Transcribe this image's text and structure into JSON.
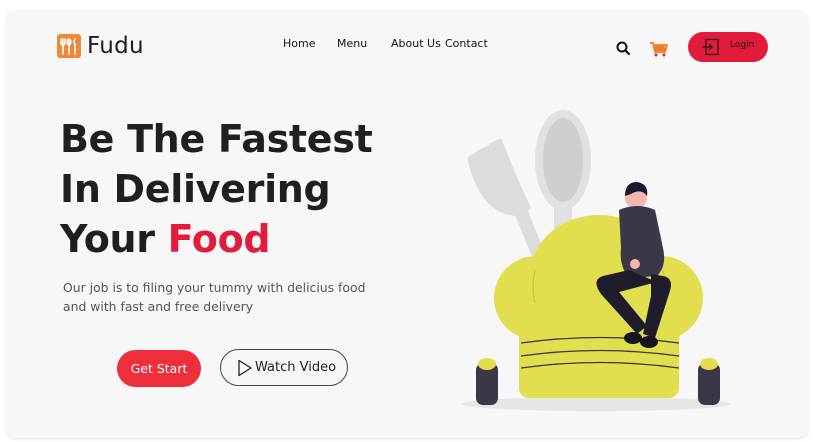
{
  "brand": {
    "name": "Fudu",
    "accent": "#e21b3c",
    "logo_color": "#f0883a"
  },
  "nav": {
    "items": [
      {
        "label": "Home"
      },
      {
        "label": "Menu"
      },
      {
        "label": "About Us"
      },
      {
        "label": "Contact"
      }
    ]
  },
  "header": {
    "search_icon": "search-icon",
    "cart_icon": "cart-icon",
    "login_label": "Login"
  },
  "hero": {
    "title_line1": "Be The Fastest",
    "title_line2": "In Delivering",
    "title_line3_prefix": "Your ",
    "title_line3_highlight": "Food",
    "subtitle_line1": "Our job is to filing your tummy with delicius food",
    "subtitle_line2": "and with fast and free delivery",
    "primary_button": "Get Start",
    "secondary_button": "Watch Video"
  },
  "illustration": {
    "name": "chef-hat-with-man-illustration",
    "hat_color": "#e2df4e",
    "figure_color": "#3a3747"
  }
}
